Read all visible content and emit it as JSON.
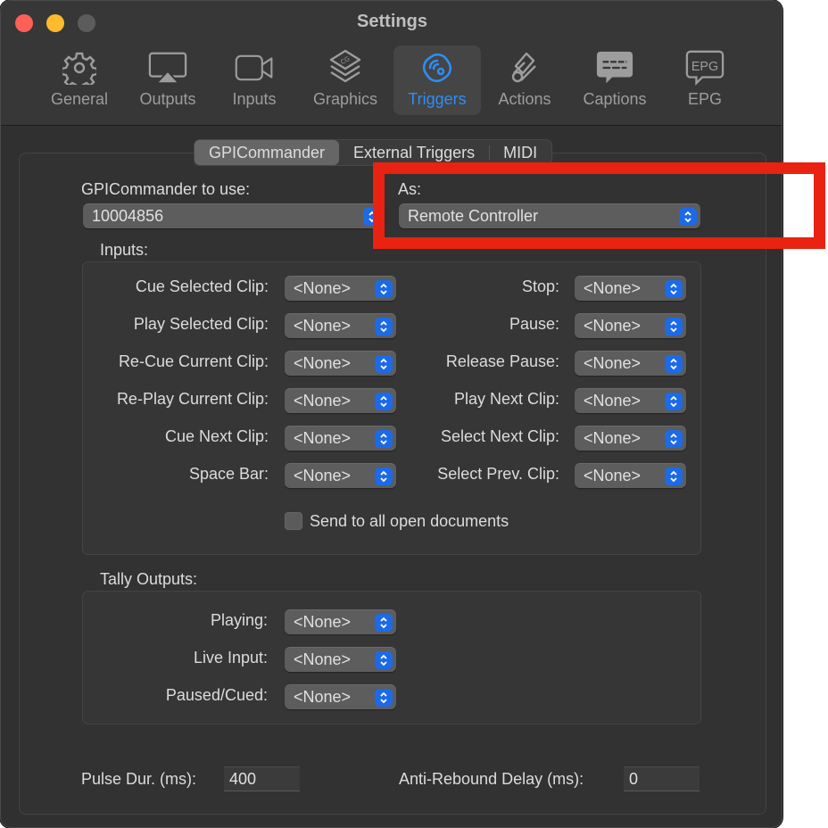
{
  "window": {
    "title": "Settings",
    "traffic_lights": [
      "close",
      "minimize",
      "zoom"
    ]
  },
  "toolbar": {
    "items": [
      {
        "label": "General",
        "icon": "gear-icon"
      },
      {
        "label": "Outputs",
        "icon": "airplay-icon"
      },
      {
        "label": "Inputs",
        "icon": "video-camera-icon"
      },
      {
        "label": "Graphics",
        "icon": "layers-cg-icon"
      },
      {
        "label": "Triggers",
        "icon": "trigger-signal-icon",
        "selected": true
      },
      {
        "label": "Actions",
        "icon": "scroll-icon"
      },
      {
        "label": "Captions",
        "icon": "caption-bubble-icon"
      },
      {
        "label": "EPG",
        "icon": "epg-bubble-icon"
      }
    ],
    "selected_color": "#2f8df7"
  },
  "tabs": {
    "items": [
      "GPICommander",
      "External Triggers",
      "MIDI"
    ],
    "active": "GPICommander"
  },
  "gpi": {
    "device_label": "GPICommander to use:",
    "device_value": "10004856",
    "as_label": "As:",
    "as_value": "Remote Controller"
  },
  "inputs": {
    "title": "Inputs:",
    "left": [
      {
        "label": "Cue Selected Clip:",
        "value": "<None>"
      },
      {
        "label": "Play Selected Clip:",
        "value": "<None>"
      },
      {
        "label": "Re-Cue Current Clip:",
        "value": "<None>"
      },
      {
        "label": "Re-Play Current Clip:",
        "value": "<None>"
      },
      {
        "label": "Cue Next Clip:",
        "value": "<None>"
      },
      {
        "label": "Space Bar:",
        "value": "<None>"
      }
    ],
    "right": [
      {
        "label": "Stop:",
        "value": "<None>"
      },
      {
        "label": "Pause:",
        "value": "<None>"
      },
      {
        "label": "Release Pause:",
        "value": "<None>"
      },
      {
        "label": "Play Next Clip:",
        "value": "<None>"
      },
      {
        "label": "Select Next Clip:",
        "value": "<None>"
      },
      {
        "label": "Select Prev. Clip:",
        "value": "<None>"
      }
    ],
    "send_all": {
      "label": "Send to all open documents",
      "checked": false
    }
  },
  "tally": {
    "title": "Tally Outputs:",
    "items": [
      {
        "label": "Playing:",
        "value": "<None>"
      },
      {
        "label": "Live Input:",
        "value": "<None>"
      },
      {
        "label": "Paused/Cued:",
        "value": "<None>"
      }
    ]
  },
  "footer": {
    "pulse_label": "Pulse Dur. (ms):",
    "pulse_value": "400",
    "rebound_label": "Anti-Rebound Delay (ms):",
    "rebound_value": "0"
  },
  "annotation": {
    "color": "#ea2211"
  },
  "colors": {
    "stepper": "#1d6ae6",
    "window_bg": "#2f302f"
  }
}
